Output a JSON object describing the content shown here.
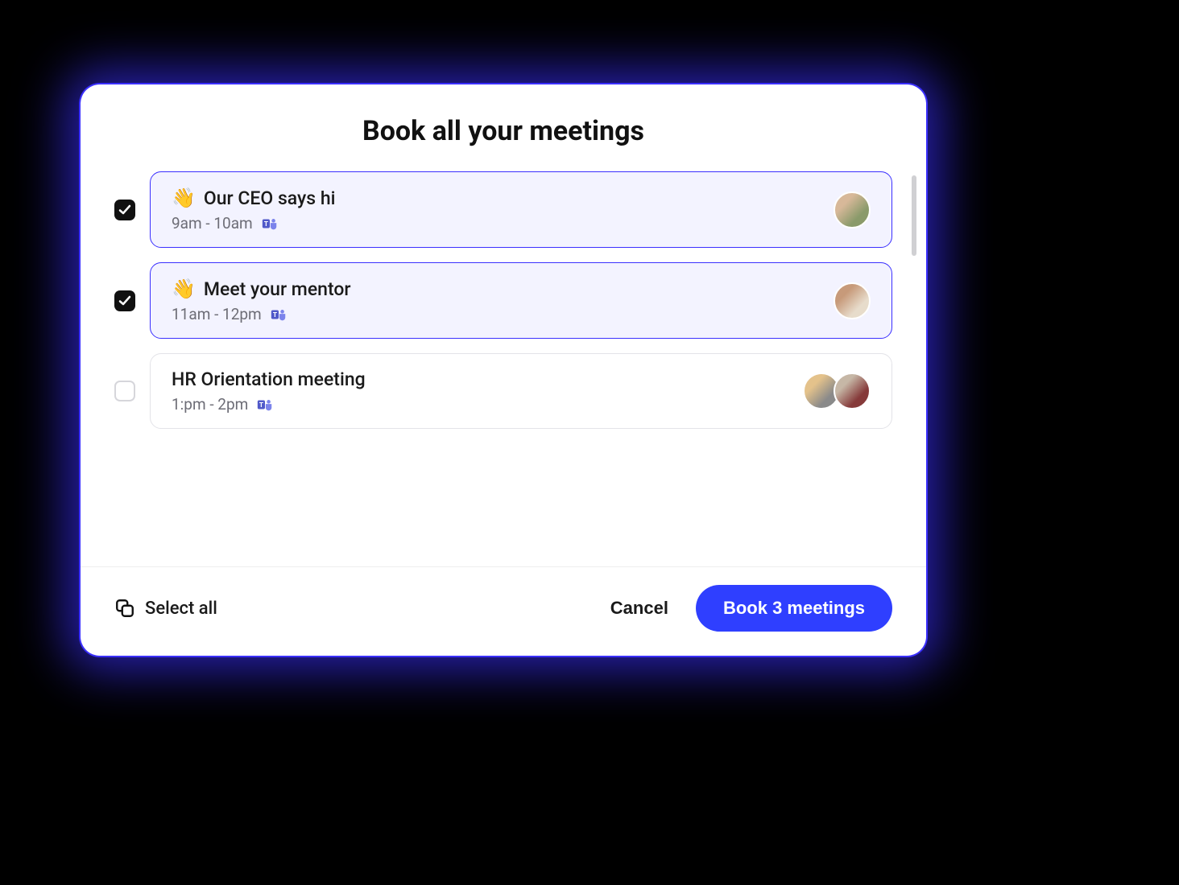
{
  "dialog": {
    "title": "Book all your meetings"
  },
  "meetings": [
    {
      "emoji": "👋",
      "title": "Our CEO says hi",
      "time": "9am - 10am",
      "selected": true,
      "avatars": 1
    },
    {
      "emoji": "👋",
      "title": "Meet your mentor",
      "time": "11am - 12pm",
      "selected": true,
      "avatars": 1
    },
    {
      "emoji": "",
      "title": "HR Orientation meeting",
      "time": "1:pm - 2pm",
      "selected": false,
      "avatars": 2
    }
  ],
  "footer": {
    "select_all_label": "Select all",
    "cancel_label": "Cancel",
    "book_label": "Book 3 meetings"
  },
  "colors": {
    "accent": "#2F3FFF"
  },
  "icons": {
    "platform": "teams-icon"
  }
}
